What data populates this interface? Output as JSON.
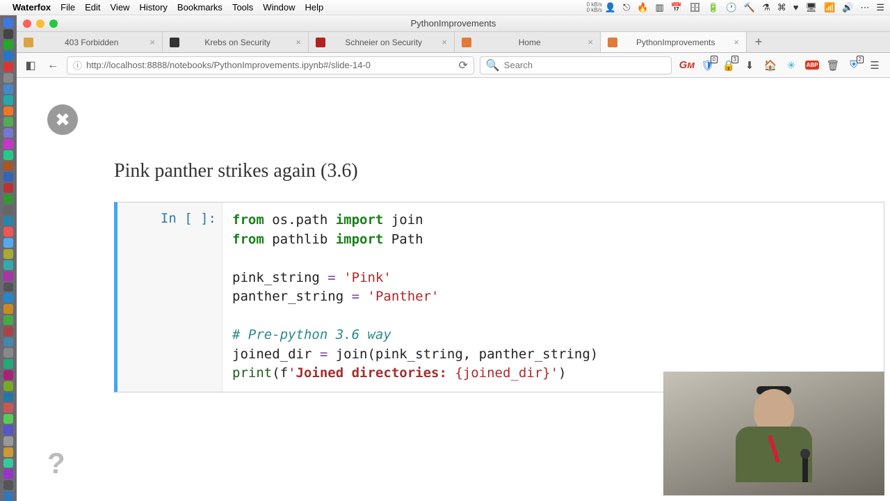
{
  "menubar": {
    "app": "Waterfox",
    "items": [
      "File",
      "Edit",
      "View",
      "History",
      "Bookmarks",
      "Tools",
      "Window",
      "Help"
    ],
    "netspeed": {
      "up": "0 kB/s",
      "down": "0 kB/s"
    }
  },
  "window": {
    "title": "PythonImprovements"
  },
  "tabs": [
    {
      "label": "403 Forbidden",
      "favicon": "#d9a441",
      "active": false
    },
    {
      "label": "Krebs on Security",
      "favicon": "#333333",
      "active": false
    },
    {
      "label": "Schneier on Security",
      "favicon": "#b22222",
      "active": false
    },
    {
      "label": "Home",
      "favicon": "#e07b39",
      "active": false
    },
    {
      "label": "PythonImprovements",
      "favicon": "#e07b39",
      "active": true
    }
  ],
  "toolbar": {
    "url": "http://localhost:8888/notebooks/PythonImprovements.ipynb#/slide-14-0",
    "search_placeholder": "Search"
  },
  "slide": {
    "title": "Pink panther strikes again (3.6)",
    "prompt": "In [ ]:",
    "code_lines": [
      {
        "t": "code",
        "tokens": [
          {
            "c": "kw",
            "s": "from"
          },
          {
            "c": "",
            "s": " os.path "
          },
          {
            "c": "kw",
            "s": "import"
          },
          {
            "c": "",
            "s": " join"
          }
        ]
      },
      {
        "t": "code",
        "tokens": [
          {
            "c": "kw",
            "s": "from"
          },
          {
            "c": "",
            "s": " pathlib "
          },
          {
            "c": "kw",
            "s": "import"
          },
          {
            "c": "",
            "s": " Path"
          }
        ]
      },
      {
        "t": "blank"
      },
      {
        "t": "code",
        "tokens": [
          {
            "c": "",
            "s": "pink_string "
          },
          {
            "c": "op",
            "s": "="
          },
          {
            "c": "",
            "s": " "
          },
          {
            "c": "str",
            "s": "'Pink'"
          }
        ]
      },
      {
        "t": "code",
        "tokens": [
          {
            "c": "",
            "s": "panther_string "
          },
          {
            "c": "op",
            "s": "="
          },
          {
            "c": "",
            "s": " "
          },
          {
            "c": "str",
            "s": "'Panther'"
          }
        ]
      },
      {
        "t": "blank"
      },
      {
        "t": "code",
        "tokens": [
          {
            "c": "cmt",
            "s": "# Pre-python 3.6 way"
          }
        ]
      },
      {
        "t": "code",
        "tokens": [
          {
            "c": "",
            "s": "joined_dir "
          },
          {
            "c": "op",
            "s": "="
          },
          {
            "c": "",
            "s": " join(pink_string, panther_string)"
          }
        ]
      },
      {
        "t": "code",
        "tokens": [
          {
            "c": "fn",
            "s": "print"
          },
          {
            "c": "",
            "s": "("
          },
          {
            "c": "",
            "s": "f"
          },
          {
            "c": "fstr",
            "s": "'"
          },
          {
            "c": "fstrlbl",
            "s": "Joined directories:"
          },
          {
            "c": "fstr",
            "s": " {joined_dir}'"
          },
          {
            "c": "",
            "s": ")"
          }
        ]
      }
    ]
  }
}
